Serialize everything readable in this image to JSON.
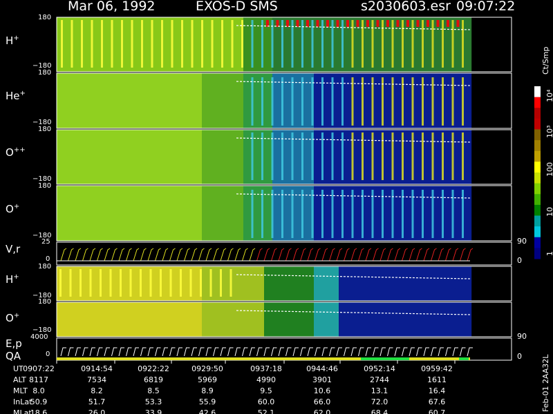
{
  "header": {
    "date": "Mar 06, 1992",
    "mission": "EXOS-D SMS",
    "file": "s2030603.esr",
    "time": "09:07:22"
  },
  "panels": [
    {
      "key": "h_plus",
      "label": "H",
      "sup": "+",
      "ymax": "180",
      "ymin": "−180"
    },
    {
      "key": "he_plus",
      "label": "He",
      "sup": "+",
      "ymax": "180",
      "ymin": "−180"
    },
    {
      "key": "o_pp",
      "label": "O",
      "sup": "++",
      "ymax": "180",
      "ymin": "−180"
    },
    {
      "key": "o_plus",
      "label": "O",
      "sup": "+",
      "ymax": "180",
      "ymin": "−180"
    },
    {
      "key": "vr",
      "label": "V,r",
      "sup": "",
      "ymax": "25",
      "ymin": "0",
      "rmax": "90",
      "rmin": "0"
    },
    {
      "key": "h_plus2",
      "label": "H",
      "sup": "+",
      "ymax": "180",
      "ymin": "−180"
    },
    {
      "key": "o_plus2",
      "label": "O",
      "sup": "+",
      "ymax": "180",
      "ymin": "−180"
    },
    {
      "key": "ep",
      "label": "E,p",
      "sup": "",
      "ymax": "4000",
      "ymin": "0",
      "rmax": "90",
      "rmin": "0"
    }
  ],
  "qa_label": "QA",
  "colorbar": {
    "unit": "Ct/Smp",
    "ticks": [
      "1",
      "10",
      "100",
      "10³",
      "10⁴"
    ],
    "colors": [
      "#ffffff",
      "#ff0000",
      "#b40000",
      "#c00000",
      "#806000",
      "#a08000",
      "#c0a000",
      "#ffff00",
      "#c8e000",
      "#80d000",
      "#40b000",
      "#008000",
      "#00a0a0",
      "#00c8e0",
      "#0000a0",
      "#000080"
    ]
  },
  "ephemeris": {
    "rows": [
      {
        "label": "UT",
        "values": [
          "0907:22",
          "0914:54",
          "0922:22",
          "0929:50",
          "0937:18",
          "0944:46",
          "0952:14",
          "0959:42"
        ]
      },
      {
        "label": "ALT",
        "values": [
          "8117",
          "7534",
          "6819",
          "5969",
          "4990",
          "3901",
          "2744",
          "1611"
        ]
      },
      {
        "label": "MLT",
        "values": [
          "8.0",
          "8.2",
          "8.5",
          "8.9",
          "9.5",
          "10.6",
          "13.1",
          "16.4"
        ]
      },
      {
        "label": "InLat",
        "values": [
          "50.9",
          "51.7",
          "53.3",
          "55.9",
          "60.0",
          "66.0",
          "72.0",
          "67.6"
        ]
      },
      {
        "label": "MLat",
        "values": [
          "18.6",
          "26.0",
          "33.9",
          "42.6",
          "52.1",
          "62.0",
          "68.4",
          "60.7"
        ]
      }
    ]
  },
  "footer_note": "Feb-01 2AA32L",
  "chart_data": {
    "type": "heatmap",
    "title": "Mar 06, 1992   EXOS-D SMS",
    "xlabel": "UT",
    "x": [
      "0907:22",
      "0914:54",
      "0922:22",
      "0929:50",
      "0937:18",
      "0944:46",
      "0952:14",
      "0959:42"
    ],
    "series": [
      {
        "name": "H+",
        "ylim": [
          -180,
          180
        ]
      },
      {
        "name": "He+",
        "ylim": [
          -180,
          180
        ]
      },
      {
        "name": "O++",
        "ylim": [
          -180,
          180
        ]
      },
      {
        "name": "O+",
        "ylim": [
          -180,
          180
        ]
      },
      {
        "name": "V,r",
        "ylim": [
          0,
          25
        ]
      },
      {
        "name": "H+",
        "ylim": [
          -180,
          180
        ]
      },
      {
        "name": "O+",
        "ylim": [
          -180,
          180
        ]
      },
      {
        "name": "E,p",
        "ylim": [
          0,
          4000
        ]
      }
    ],
    "colorbar_unit": "Ct/Smp",
    "colorbar_ticks": [
      "1",
      "10",
      "100",
      "10³",
      "10⁴"
    ]
  }
}
